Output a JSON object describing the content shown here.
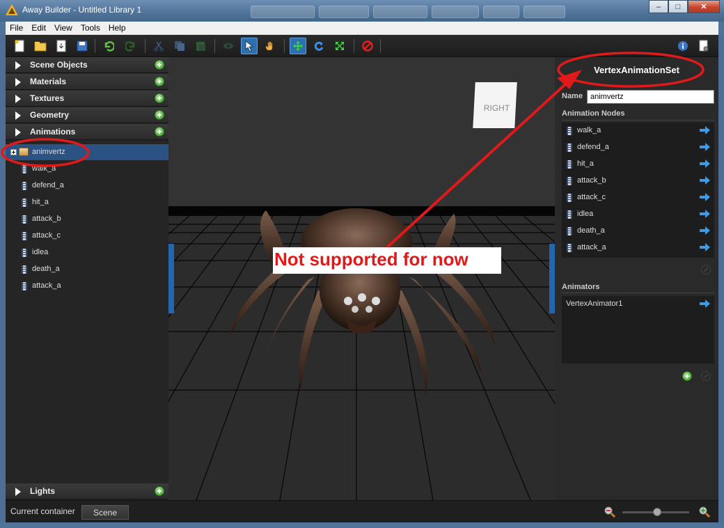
{
  "window": {
    "title": "Away Builder - Untitled Library 1",
    "controls": {
      "minimize": "–",
      "maximize": "□",
      "close": "✕"
    }
  },
  "menu": [
    "File",
    "Edit",
    "View",
    "Tools",
    "Help"
  ],
  "toolbar": {
    "buttons": [
      {
        "name": "new-document-icon",
        "glyph": "🗎"
      },
      {
        "name": "open-folder-icon",
        "glyph": "📂"
      },
      {
        "name": "import-icon",
        "glyph": "⇩"
      },
      {
        "name": "save-icon",
        "glyph": "💾"
      },
      {
        "name": "undo-icon",
        "glyph": "↶"
      },
      {
        "name": "redo-icon",
        "glyph": "↷"
      },
      {
        "name": "cut-icon",
        "glyph": "✂"
      },
      {
        "name": "copy-icon",
        "glyph": "❐"
      },
      {
        "name": "paste-icon",
        "glyph": "⎘"
      },
      {
        "name": "eye-icon",
        "glyph": "◉"
      },
      {
        "name": "select-arrow-icon",
        "glyph": "↖",
        "active": true
      },
      {
        "name": "hand-pan-icon",
        "glyph": "✋"
      },
      {
        "name": "move-icon",
        "glyph": "✚",
        "active": true
      },
      {
        "name": "rotate-icon",
        "glyph": "↻"
      },
      {
        "name": "scale-icon",
        "glyph": "⤢"
      },
      {
        "name": "delete-icon",
        "glyph": "⊘"
      },
      {
        "name": "info-icon",
        "glyph": "i"
      },
      {
        "name": "settings-icon",
        "glyph": "⚙"
      }
    ]
  },
  "left_panel": {
    "sections": [
      {
        "label": "Scene Objects",
        "expanded": false
      },
      {
        "label": "Materials",
        "expanded": false
      },
      {
        "label": "Textures",
        "expanded": false
      },
      {
        "label": "Geometry",
        "expanded": false
      },
      {
        "label": "Animations",
        "expanded": true
      }
    ],
    "tree": {
      "parent": "animvertz",
      "children": [
        "walk_a",
        "defend_a",
        "hit_a",
        "attack_b",
        "attack_c",
        "idlea",
        "death_a",
        "attack_a"
      ]
    },
    "bottom_section": {
      "label": "Lights",
      "expanded": false
    }
  },
  "viewport": {
    "view_cube_label": "RIGHT"
  },
  "right_panel": {
    "title": "VertexAnimationSet",
    "name_label": "Name",
    "name_value": "animvertz",
    "nodes_label": "Animation Nodes",
    "nodes": [
      "walk_a",
      "defend_a",
      "hit_a",
      "attack_b",
      "attack_c",
      "idlea",
      "death_a",
      "attack_a"
    ],
    "animators_label": "Animators",
    "animators": [
      "VertexAnimator1"
    ]
  },
  "statusbar": {
    "container_label": "Current container",
    "container_value": "Scene",
    "zoom_level": 0.5
  },
  "annotation": {
    "text": "Not supported for now",
    "color": "#e01a1a"
  },
  "colors": {
    "selection": "#2a5282",
    "accent": "#2466ae",
    "annotation_red": "#e01a1a"
  }
}
